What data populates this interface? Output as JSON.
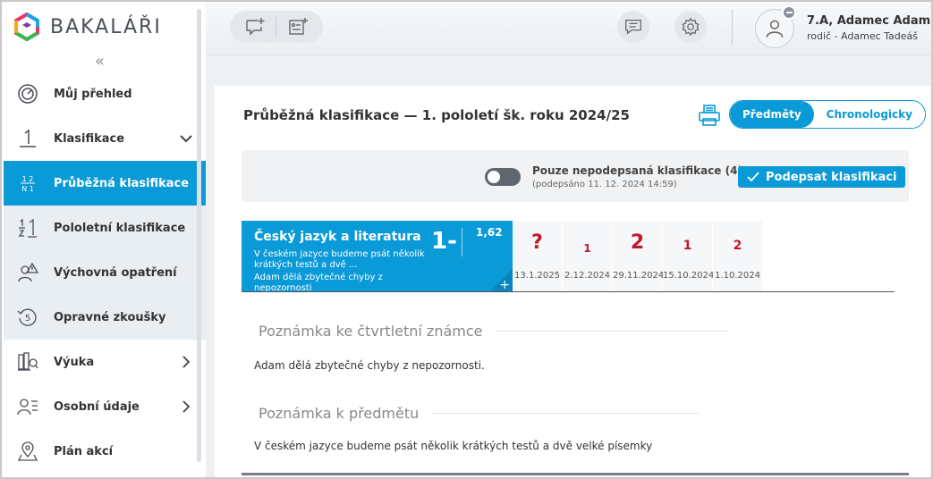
{
  "app": {
    "logo_text": "BAKALÁŘI"
  },
  "sidebar": {
    "items": [
      {
        "label": "Můj přehled"
      },
      {
        "label": "Klasifikace"
      },
      {
        "label": "Průběžná klasifikace",
        "icon_text_top": "1 2",
        "icon_text_bottom": "N 1"
      },
      {
        "label": "Pololetní klasifikace"
      },
      {
        "label": "Výchovná opatření"
      },
      {
        "label": "Opravné zkoušky"
      },
      {
        "label": "Výuka"
      },
      {
        "label": "Osobní údaje"
      },
      {
        "label": "Plán akcí"
      }
    ]
  },
  "user": {
    "name": "7.A, Adamec Adam",
    "role": "rodič - Adamec Tadeáš"
  },
  "page": {
    "title": "Průběžná klasifikace  —  1. pololetí šk. roku 2024/25",
    "views": [
      "Předměty",
      "Chronologicky"
    ]
  },
  "filter": {
    "label": "Pouze nepodepsaná klasifikace (4)",
    "sub": "(podepsáno 11. 12. 2024 14:59)",
    "sign_label": "Podepsat klasifikaci"
  },
  "subject": {
    "name": "Český jazyk a literatura",
    "description": "V českém jazyce budeme psát několik krátkých testů a dvě ...",
    "note": "Adam dělá zbytečné chyby z nepozornosti",
    "grade": "1-",
    "average": "1,62",
    "plus": "+"
  },
  "grades": [
    {
      "value": "?",
      "date": "13.1.2025"
    },
    {
      "value": "1",
      "date": "2.12.2024"
    },
    {
      "value": "2",
      "date": "29.11.2024"
    },
    {
      "value": "1",
      "date": "15.10.2024"
    },
    {
      "value": "2",
      "date": "1.10.2024"
    }
  ],
  "sections": {
    "quarter_note_title": "Poznámka ke čtvrtletní známce",
    "quarter_note_text": "Adam dělá zbytečné chyby z nepozornosti.",
    "subject_note_title": "Poznámka k předmětu",
    "subject_note_text": "V českém jazyce budeme psát několik krátkých testů a dvě velké písemky"
  },
  "colors": {
    "accent": "#0b9ad8",
    "grade_red": "#c0182a"
  }
}
